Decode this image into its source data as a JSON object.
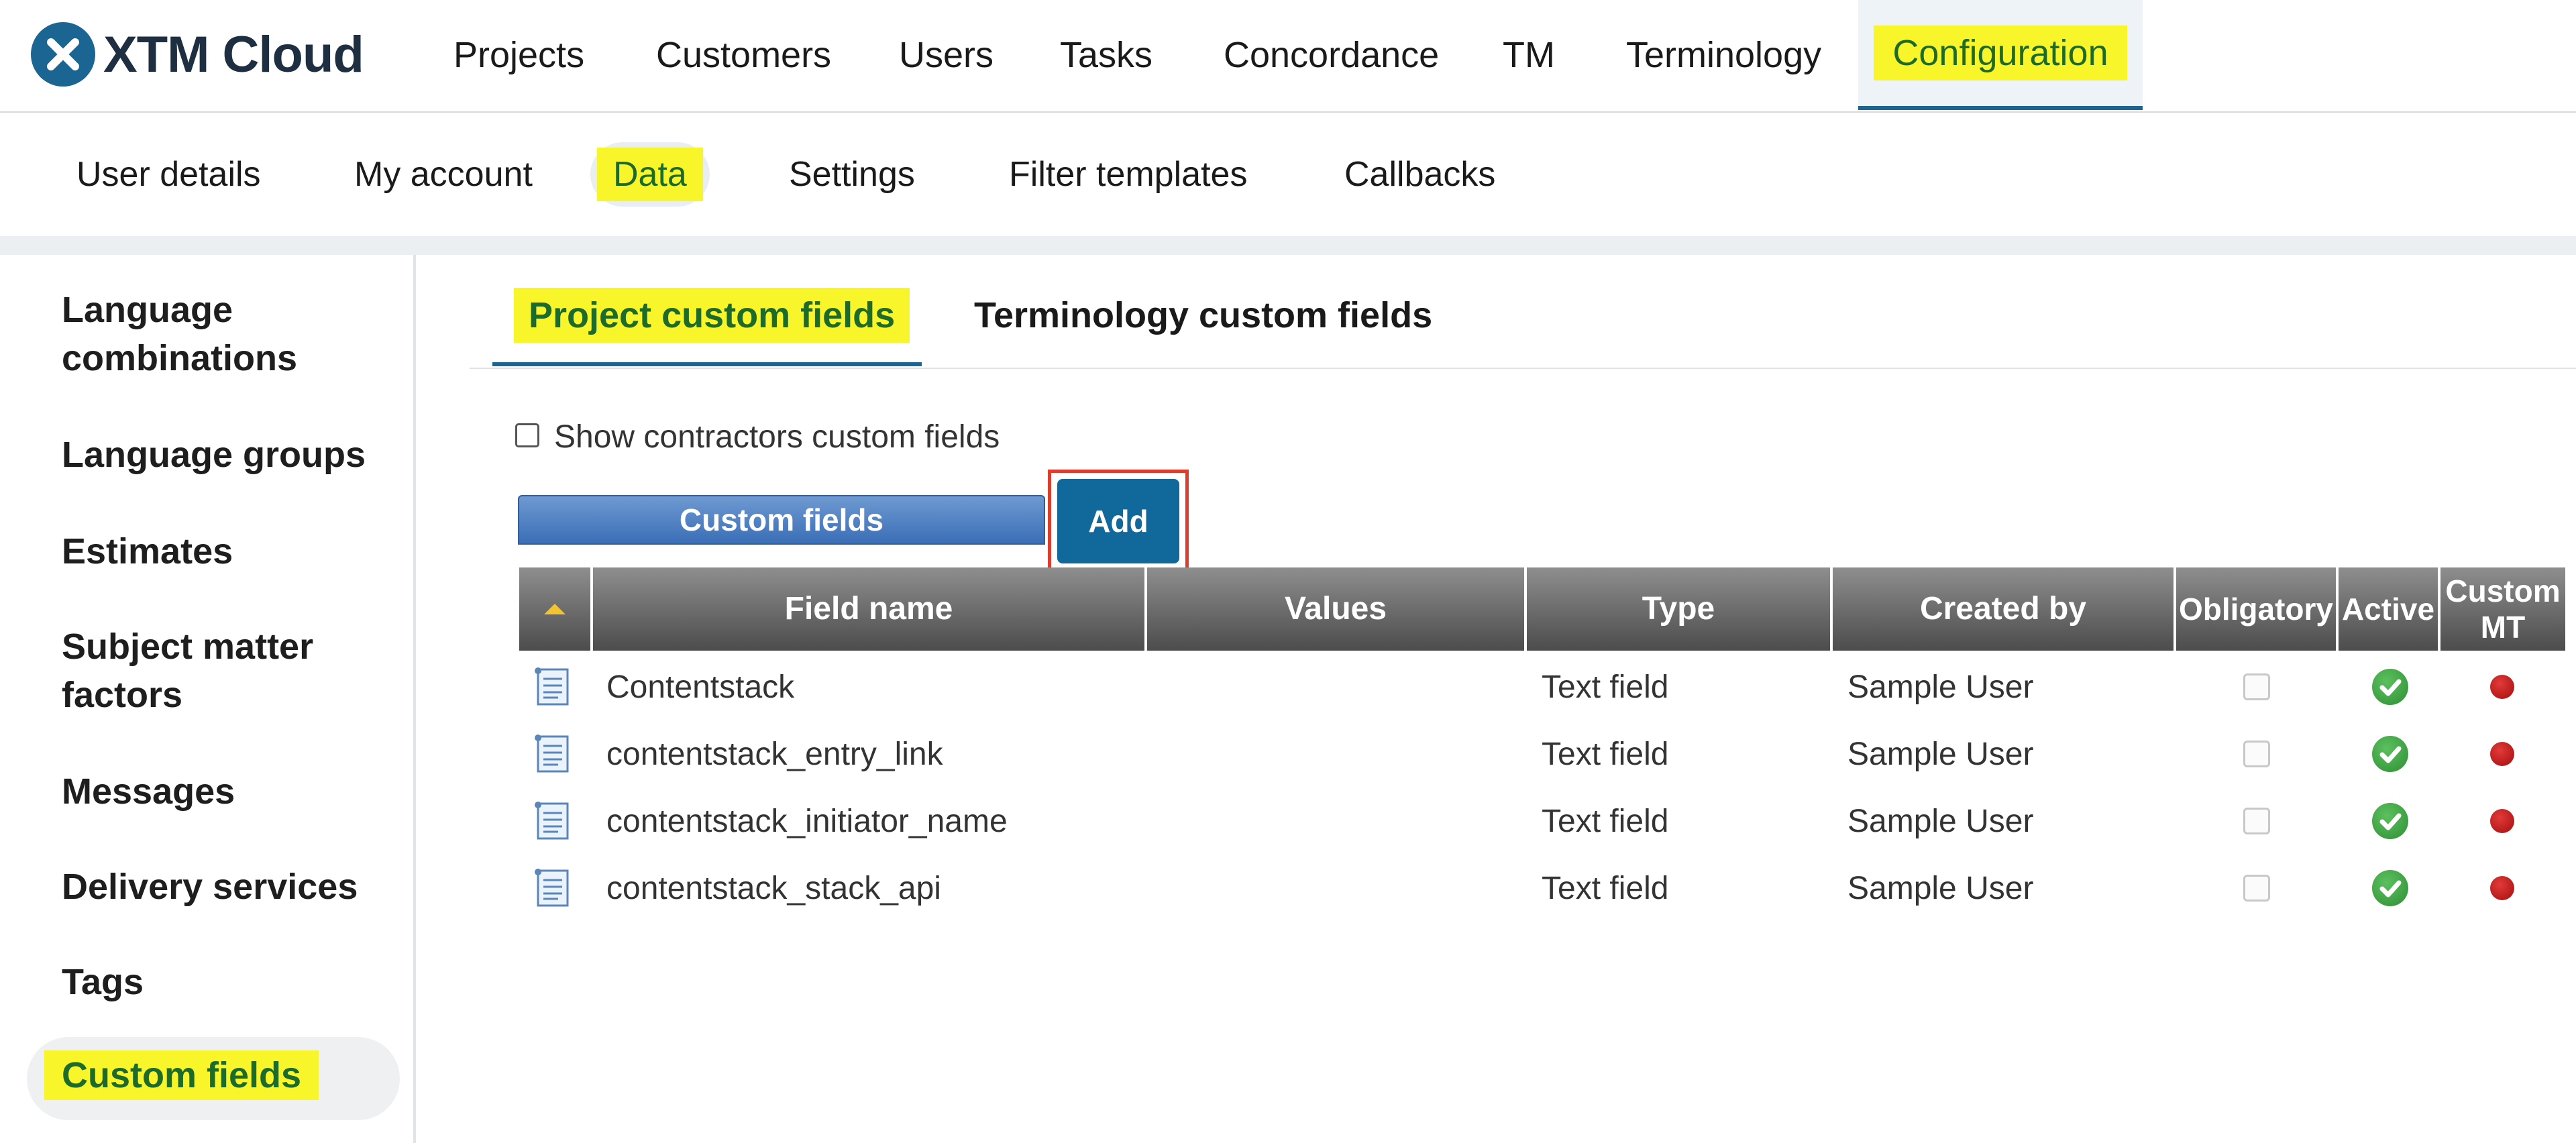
{
  "app": {
    "brand": "XTM Cloud"
  },
  "top_nav": [
    "Projects",
    "Customers",
    "Users",
    "Tasks",
    "Concordance",
    "TM",
    "Terminology",
    "Configuration"
  ],
  "sub_nav": [
    "User details",
    "My account",
    "Data",
    "Settings",
    "Filter templates",
    "Callbacks"
  ],
  "sidebar": [
    "Language combinations",
    "Language groups",
    "Estimates",
    "Subject matter factors",
    "Messages",
    "Delivery services",
    "Tags",
    "Custom fields"
  ],
  "content_tabs": [
    "Project custom fields",
    "Terminology custom fields"
  ],
  "show_contractors_label": "Show contractors custom fields",
  "custom_fields_header": "Custom fields",
  "add_label": "Add",
  "table": {
    "columns": [
      "Field name",
      "Values",
      "Type",
      "Created by",
      "Obligatory",
      "Active",
      "Custom MT"
    ],
    "rows": [
      {
        "field_name": "Contentstack",
        "values": "",
        "type": "Text field",
        "created_by": "Sample User",
        "obligatory": false,
        "active": true,
        "custom_mt": false
      },
      {
        "field_name": "contentstack_entry_link",
        "values": "",
        "type": "Text field",
        "created_by": "Sample User",
        "obligatory": false,
        "active": true,
        "custom_mt": false
      },
      {
        "field_name": "contentstack_initiator_name",
        "values": "",
        "type": "Text field",
        "created_by": "Sample User",
        "obligatory": false,
        "active": true,
        "custom_mt": false
      },
      {
        "field_name": "contentstack_stack_api",
        "values": "",
        "type": "Text field",
        "created_by": "Sample User",
        "obligatory": false,
        "active": true,
        "custom_mt": false
      }
    ]
  },
  "colors": {
    "accent": "#1a6591",
    "highlight": "#f8f52a",
    "highlight_text": "#1c6b2a",
    "add_outline": "#e03c2e"
  }
}
